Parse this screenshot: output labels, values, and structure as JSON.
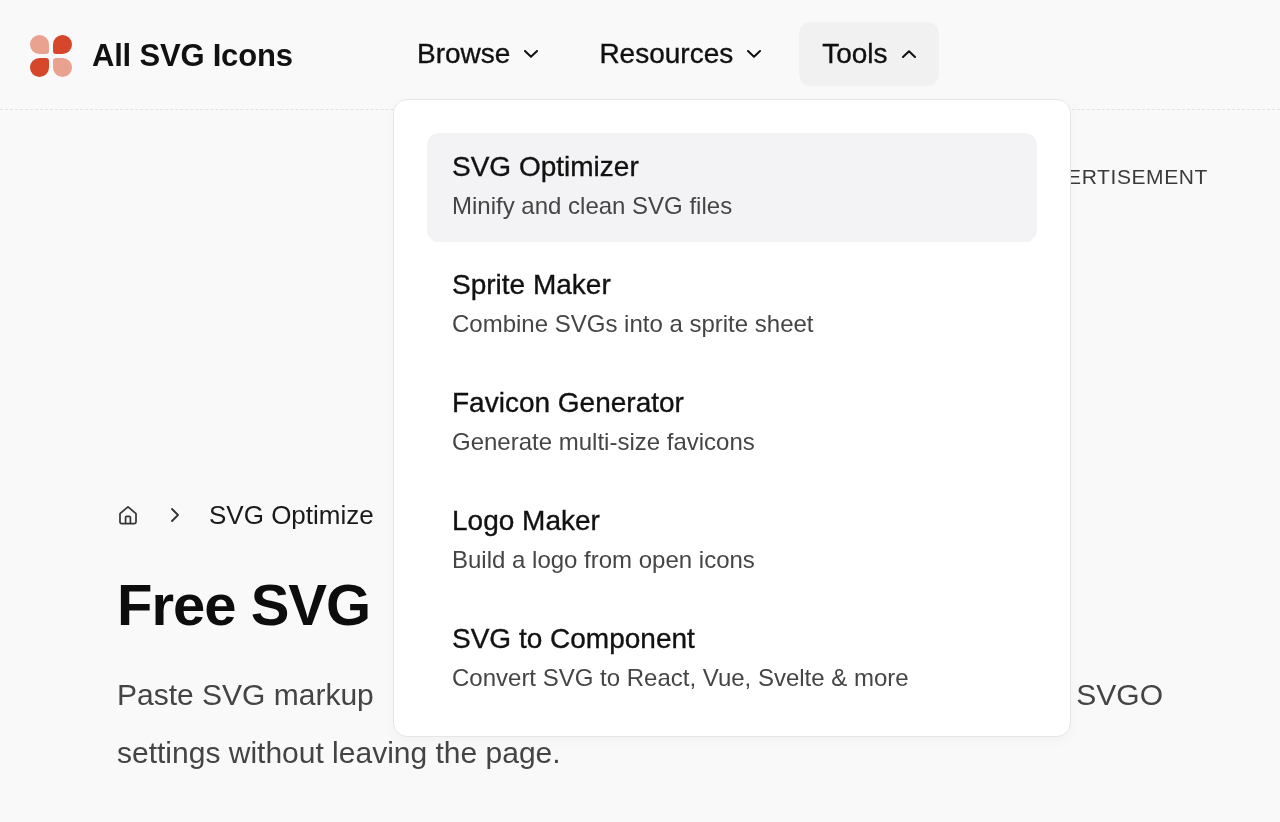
{
  "header": {
    "site_title": "All SVG Icons",
    "nav": [
      {
        "label": "Browse",
        "expanded": false
      },
      {
        "label": "Resources",
        "expanded": false
      },
      {
        "label": "Tools",
        "expanded": true
      }
    ]
  },
  "dropdown": {
    "items": [
      {
        "title": "SVG Optimizer",
        "description": "Minify and clean SVG files",
        "selected": true
      },
      {
        "title": "Sprite Maker",
        "description": "Combine SVGs into a sprite sheet",
        "selected": false
      },
      {
        "title": "Favicon Generator",
        "description": "Generate multi-size favicons",
        "selected": false
      },
      {
        "title": "Logo Maker",
        "description": "Build a logo from open icons",
        "selected": false
      },
      {
        "title": "SVG to Component",
        "description": "Convert SVG to React, Vue, Svelte & more",
        "selected": false
      }
    ]
  },
  "advertisement": {
    "label": "ERTISEMENT"
  },
  "breadcrumb": {
    "current": "SVG Optimize"
  },
  "heading": "Free SVG",
  "intro": {
    "line_1_start": "Paste SVG markup",
    "line_1_end": "SVGO",
    "line_2": "settings without leaving the page."
  }
}
